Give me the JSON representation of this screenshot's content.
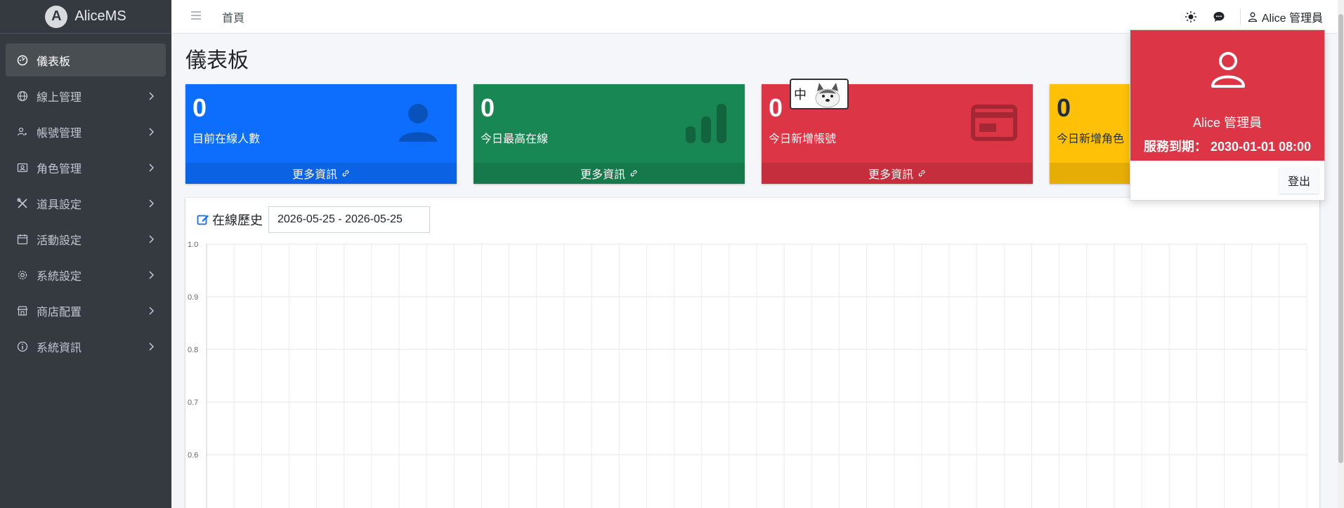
{
  "app": {
    "brand": "AliceMS",
    "logo_letter": "A"
  },
  "sidebar": {
    "items": [
      {
        "label": "儀表板",
        "icon": "dashboard-icon",
        "active": true
      },
      {
        "label": "線上管理",
        "icon": "globe-icon"
      },
      {
        "label": "帳號管理",
        "icon": "users-icon"
      },
      {
        "label": "角色管理",
        "icon": "id-badge-icon"
      },
      {
        "label": "道具設定",
        "icon": "tools-icon"
      },
      {
        "label": "活動設定",
        "icon": "calendar-icon"
      },
      {
        "label": "系統設定",
        "icon": "gear-icon"
      },
      {
        "label": "商店配置",
        "icon": "store-icon"
      },
      {
        "label": "系統資訊",
        "icon": "info-icon"
      }
    ]
  },
  "topbar": {
    "breadcrumb": "首頁",
    "user": "Alice 管理員"
  },
  "page": {
    "title": "儀表板"
  },
  "boxes": [
    {
      "value": "0",
      "label": "目前在線人數",
      "footer": "更多資訊",
      "color": "#0d6efd",
      "icon": "user-icon"
    },
    {
      "value": "0",
      "label": "今日最高在線",
      "footer": "更多資訊",
      "color": "#198754",
      "icon": "bar-chart-icon"
    },
    {
      "value": "0",
      "label": "今日新增帳號",
      "footer": "更多資訊",
      "color": "#dc3545",
      "icon": "card-icon"
    },
    {
      "value": "0",
      "label": "今日新增角色",
      "footer": "",
      "color": "#ffc107",
      "icon": "person-icon"
    }
  ],
  "history": {
    "title": "在線歷史",
    "date_range": "2026-05-25 - 2026-05-25"
  },
  "chart_data": {
    "type": "line",
    "title": "",
    "xlabel": "",
    "ylabel": "",
    "ylim": [
      0.5,
      1.0
    ],
    "yticks": [
      "1.0",
      "0.9",
      "0.8",
      "0.7",
      "0.6"
    ],
    "series": [],
    "grid": true
  },
  "user_dropdown": {
    "name": "Alice 管理員",
    "expire_label": "服務到期：",
    "expire_value": "2030-01-01 08:00",
    "logout": "登出",
    "color": "#dc3545"
  },
  "ime": {
    "label": "中"
  }
}
